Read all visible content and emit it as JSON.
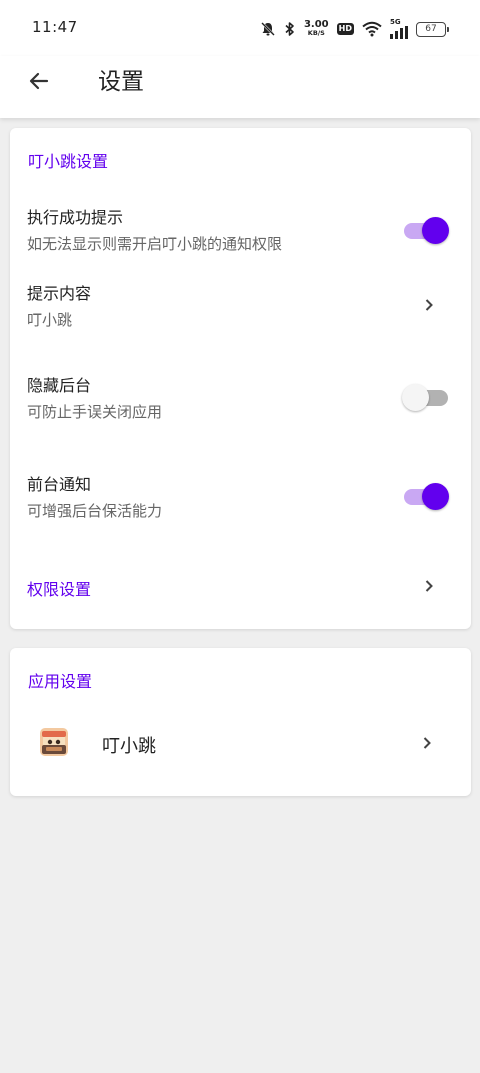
{
  "status_bar": {
    "time": "11:47",
    "speed_value": "3.00",
    "speed_unit": "KB/S",
    "hd_label": "HD",
    "network_label": "5G",
    "battery": "67",
    "icons": [
      "mute-bell-icon",
      "bluetooth-icon",
      "wifi-icon",
      "signal-icon",
      "battery-icon"
    ]
  },
  "app_bar": {
    "title": "设置",
    "back_icon": "arrow-left-icon"
  },
  "dingxiaotiao_settings": {
    "section_title": "叮小跳设置",
    "success_hint": {
      "title": "执行成功提示",
      "subtitle": "如无法显示则需开启叮小跳的通知权限",
      "enabled": true
    },
    "hint_content": {
      "title": "提示内容",
      "value": "叮小跳"
    },
    "hide_background": {
      "title": "隐藏后台",
      "subtitle": "可防止手误关闭应用",
      "enabled": false
    },
    "foreground_notification": {
      "title": "前台通知",
      "subtitle": "可增强后台保活能力",
      "enabled": true
    },
    "permission_settings": {
      "label": "权限设置"
    }
  },
  "app_settings": {
    "section_title": "应用设置",
    "app_name": "叮小跳"
  },
  "colors": {
    "accent": "#6200ee",
    "switch_on_track": "#c9a8f3",
    "background": "#efefef"
  }
}
